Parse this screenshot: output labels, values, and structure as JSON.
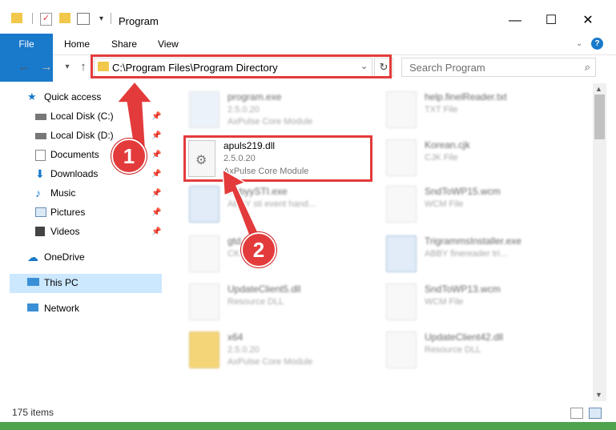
{
  "window": {
    "title": "Program",
    "colors": {
      "accent": "#1979ca",
      "highlight": "#e33b3b",
      "selection": "#cce8ff"
    }
  },
  "ribbon": {
    "tabs": [
      "File",
      "Home",
      "Share",
      "View"
    ]
  },
  "address": {
    "path": "C:\\Program Files\\Program Directory"
  },
  "search": {
    "placeholder": "Search Program"
  },
  "nav": {
    "items": [
      {
        "label": "Quick access",
        "icon": "star-icon"
      },
      {
        "label": "Local Disk (C:)",
        "icon": "drive-icon"
      },
      {
        "label": "Local Disk (D:)",
        "icon": "drive-icon"
      },
      {
        "label": "Documents",
        "icon": "documents-icon"
      },
      {
        "label": "Downloads",
        "icon": "download-icon"
      },
      {
        "label": "Music",
        "icon": "music-icon"
      },
      {
        "label": "Pictures",
        "icon": "pictures-icon"
      },
      {
        "label": "Videos",
        "icon": "videos-icon"
      },
      {
        "label": "OneDrive",
        "icon": "cloud-icon"
      },
      {
        "label": "This PC",
        "icon": "computer-icon"
      },
      {
        "label": "Network",
        "icon": "network-icon"
      }
    ]
  },
  "files": [
    {
      "name": "program.exe",
      "line2": "2.5.0.20",
      "line3": "AxPulse Core Module"
    },
    {
      "name": "help.finelReader.txt",
      "line2": "TXT File",
      "line3": ""
    },
    {
      "name": "apuls219.dll",
      "line2": "2.5.0.20",
      "line3": "AxPulse Core Module"
    },
    {
      "name": "Korean.cjk",
      "line2": "CJK File",
      "line3": ""
    },
    {
      "name": "AbbyySTI.exe",
      "line2": "ABBY sti event hand...",
      "line3": ""
    },
    {
      "name": "SndToWP15.wcm",
      "line2": "WCM File",
      "line3": ""
    },
    {
      "name": "gtd.c...",
      "line2": "CK File",
      "line3": ""
    },
    {
      "name": "TrigrammsInstaller.exe",
      "line2": "ABBY finereader tri...",
      "line3": ""
    },
    {
      "name": "UpdateClient5.dll",
      "line2": "Resource DLL",
      "line3": ""
    },
    {
      "name": "SndToWP13.wcm",
      "line2": "WCM File",
      "line3": ""
    },
    {
      "name": "x64",
      "line2": "2.5.0.20",
      "line3": "AxPulse Core Module"
    },
    {
      "name": "UpdateClient42.dll",
      "line2": "Resource DLL",
      "line3": ""
    }
  ],
  "status": {
    "count": "175 items"
  },
  "callouts": [
    "1",
    "2"
  ]
}
